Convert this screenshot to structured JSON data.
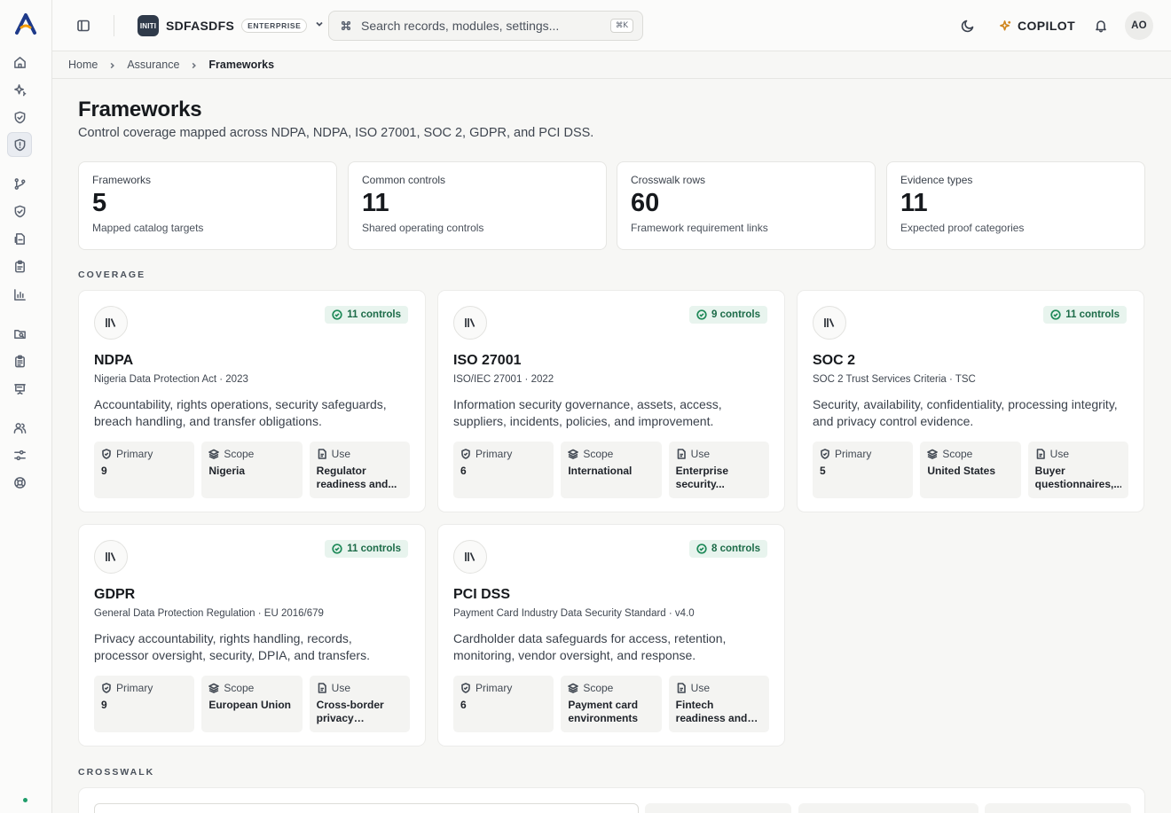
{
  "org": {
    "badge": "INITI",
    "name": "SDFASDFS",
    "plan": "ENTERPRISE"
  },
  "search": {
    "placeholder": "Search records, modules, settings...",
    "shortcut": "⌘K"
  },
  "topbar": {
    "copilot_label": "COPILOT",
    "avatar_initials": "AO"
  },
  "breadcrumb": [
    "Home",
    "Assurance",
    "Frameworks"
  ],
  "page": {
    "title": "Frameworks",
    "subtitle": "Control coverage mapped across NDPA, NDPA, ISO 27001, SOC 2, GDPR, and PCI DSS."
  },
  "stats": [
    {
      "label": "Frameworks",
      "value": "5",
      "desc": "Mapped catalog targets"
    },
    {
      "label": "Common controls",
      "value": "11",
      "desc": "Shared operating controls"
    },
    {
      "label": "Crosswalk rows",
      "value": "60",
      "desc": "Framework requirement links"
    },
    {
      "label": "Evidence types",
      "value": "11",
      "desc": "Expected proof categories"
    }
  ],
  "sections": {
    "coverage": "COVERAGE",
    "crosswalk": "CROSSWALK"
  },
  "tile_labels": {
    "primary": "Primary",
    "scope": "Scope",
    "use": "Use"
  },
  "frameworks": [
    {
      "name": "NDPA",
      "meta": "Nigeria Data Protection Act · 2023",
      "badge": "11 controls",
      "desc": "Accountability, rights operations, security safeguards, breach handling, and transfer obligations.",
      "primary": "9",
      "scope": "Nigeria",
      "use": "Regulator readiness and..."
    },
    {
      "name": "ISO 27001",
      "meta": "ISO/IEC 27001 · 2022",
      "badge": "9 controls",
      "desc": "Information security governance, assets, access, suppliers, incidents, policies, and improvement.",
      "primary": "6",
      "scope": "International",
      "use": "Enterprise security..."
    },
    {
      "name": "SOC 2",
      "meta": "SOC 2 Trust Services Criteria · TSC",
      "badge": "11 controls",
      "desc": "Security, availability, confidentiality, processing integrity, and privacy control evidence.",
      "primary": "5",
      "scope": "United States",
      "use": "Buyer questionnaires,..."
    },
    {
      "name": "GDPR",
      "meta": "General Data Protection Regulation · EU 2016/679",
      "badge": "11 controls",
      "desc": "Privacy accountability, rights handling, records, processor oversight, security, DPIA, and transfers.",
      "primary": "9",
      "scope": "European Union",
      "use": "Cross-border privacy diligenc..."
    },
    {
      "name": "PCI DSS",
      "meta": "Payment Card Industry Data Security Standard · v4.0",
      "badge": "8 controls",
      "desc": "Cardholder data safeguards for access, retention, monitoring, vendor oversight, and response.",
      "primary": "6",
      "scope": "Payment card environments",
      "use": "Fintech readiness and payment..."
    }
  ],
  "colors": {
    "accent_green": "#1f8a59",
    "badge_bg": "#e8f4ee",
    "copilot": "#d0861e",
    "logo": "#2563eb"
  }
}
